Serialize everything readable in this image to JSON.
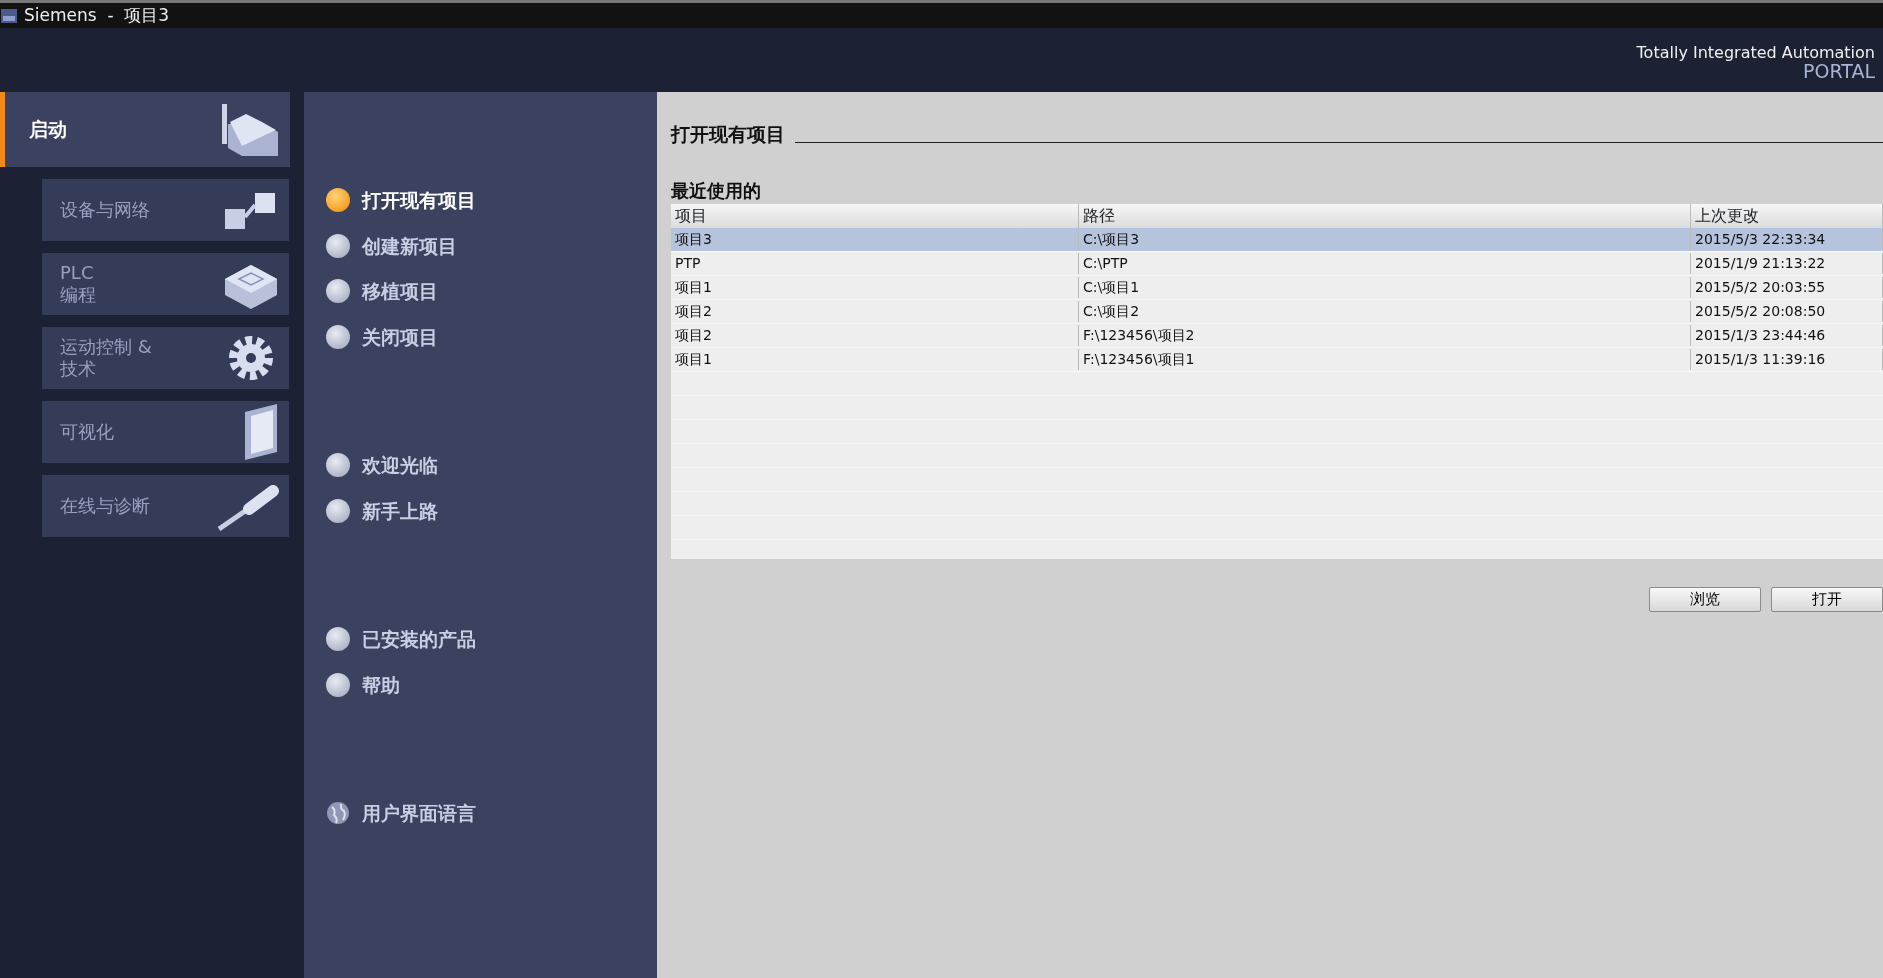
{
  "window": {
    "title": "Siemens  -  项目3"
  },
  "header": {
    "line1": "Totally Integrated Automation",
    "line2": "PORTAL"
  },
  "portals": [
    {
      "label": "启动",
      "kind": "main",
      "selected": true
    },
    {
      "label": "设备与网络",
      "kind": "devices",
      "selected": false
    },
    {
      "label": "PLC\n编程",
      "kind": "plc",
      "selected": false
    },
    {
      "label": "运动控制 &\n技术",
      "kind": "motion",
      "selected": false
    },
    {
      "label": "可视化",
      "kind": "hmi",
      "selected": false
    },
    {
      "label": "在线与诊断",
      "kind": "online",
      "selected": false
    }
  ],
  "action_groups": [
    {
      "items": [
        {
          "label": "打开现有项目",
          "kind": "dot",
          "selected": true
        },
        {
          "label": "创建新项目",
          "kind": "dot",
          "selected": false
        },
        {
          "label": "移植项目",
          "kind": "dot",
          "selected": false
        },
        {
          "label": "关闭项目",
          "kind": "dot",
          "selected": false
        }
      ]
    },
    {
      "items": [
        {
          "label": "欢迎光临",
          "kind": "dot",
          "selected": false
        },
        {
          "label": "新手上路",
          "kind": "dot",
          "selected": false
        }
      ]
    },
    {
      "items": [
        {
          "label": "已安装的产品",
          "kind": "dot",
          "selected": false
        },
        {
          "label": "帮助",
          "kind": "dot",
          "selected": false
        }
      ]
    },
    {
      "items": [
        {
          "label": "用户界面语言",
          "kind": "globe",
          "selected": false
        }
      ]
    }
  ],
  "content": {
    "title": "打开现有项目",
    "section": "最近使用的",
    "table": {
      "columns": [
        "项目",
        "路径",
        "上次更改"
      ],
      "rows": [
        {
          "cells": [
            "项目3",
            "C:\\项目3",
            "2015/5/3 22:33:34"
          ],
          "selected": true
        },
        {
          "cells": [
            "PTP",
            "C:\\PTP",
            "2015/1/9 21:13:22"
          ],
          "selected": false
        },
        {
          "cells": [
            "项目1",
            "C:\\项目1",
            "2015/5/2 20:03:55"
          ],
          "selected": false
        },
        {
          "cells": [
            "项目2",
            "C:\\项目2",
            "2015/5/2 20:08:50"
          ],
          "selected": false
        },
        {
          "cells": [
            "项目2",
            "F:\\123456\\项目2",
            "2015/1/3 23:44:46"
          ],
          "selected": false
        },
        {
          "cells": [
            "项目1",
            "F:\\123456\\项目1",
            "2015/1/3 11:39:16"
          ],
          "selected": false
        }
      ]
    },
    "buttons": [
      "浏览",
      "打开"
    ]
  }
}
